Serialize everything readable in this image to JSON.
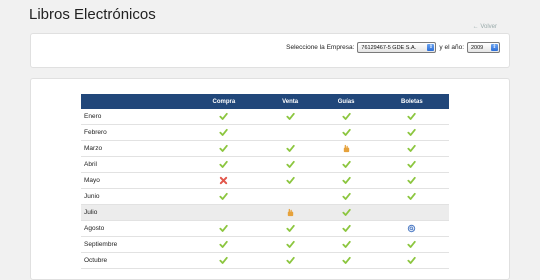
{
  "page": {
    "title": "Libros Electrónicos",
    "back_link": "← Volver"
  },
  "filter": {
    "company_label": "Seleccione la Empresa:",
    "company_value": "76129467-5 GDE S.A.",
    "year_label": "y el año:",
    "year_value": "2009"
  },
  "table": {
    "columns": [
      "",
      "Compra",
      "Venta",
      "Guías",
      "Boletas"
    ],
    "rows": [
      {
        "month": "Enero",
        "cells": [
          "check",
          "check",
          "check",
          "check"
        ]
      },
      {
        "month": "Febrero",
        "cells": [
          "check",
          "",
          "check",
          "check"
        ]
      },
      {
        "month": "Marzo",
        "cells": [
          "check",
          "check",
          "pending",
          "check"
        ]
      },
      {
        "month": "Abril",
        "cells": [
          "check",
          "check",
          "check",
          "check"
        ]
      },
      {
        "month": "Mayo",
        "cells": [
          "error",
          "check",
          "check",
          "check"
        ]
      },
      {
        "month": "Junio",
        "cells": [
          "check",
          "",
          "check",
          "check"
        ]
      },
      {
        "month": "Julio",
        "cells": [
          "",
          "pending",
          "check",
          ""
        ]
      },
      {
        "month": "Agosto",
        "cells": [
          "check",
          "check",
          "check",
          "search"
        ]
      },
      {
        "month": "Septiembre",
        "cells": [
          "check",
          "check",
          "check",
          "check"
        ]
      },
      {
        "month": "Octubre",
        "cells": [
          "check",
          "check",
          "check",
          "check"
        ]
      }
    ],
    "shaded_rows": [
      "Julio"
    ]
  },
  "status_icons": {
    "check": {
      "icon": "checkmark-icon",
      "color": "#8cc63f"
    },
    "error": {
      "icon": "x-icon",
      "color": "#e2574c"
    },
    "pending": {
      "icon": "hand-icon",
      "color": "#e6a23c"
    },
    "search": {
      "icon": "magnifier-icon",
      "color": "#4a78c2"
    }
  },
  "colors": {
    "header_bg": "#21477a",
    "page_bg": "#f1f1f1"
  }
}
